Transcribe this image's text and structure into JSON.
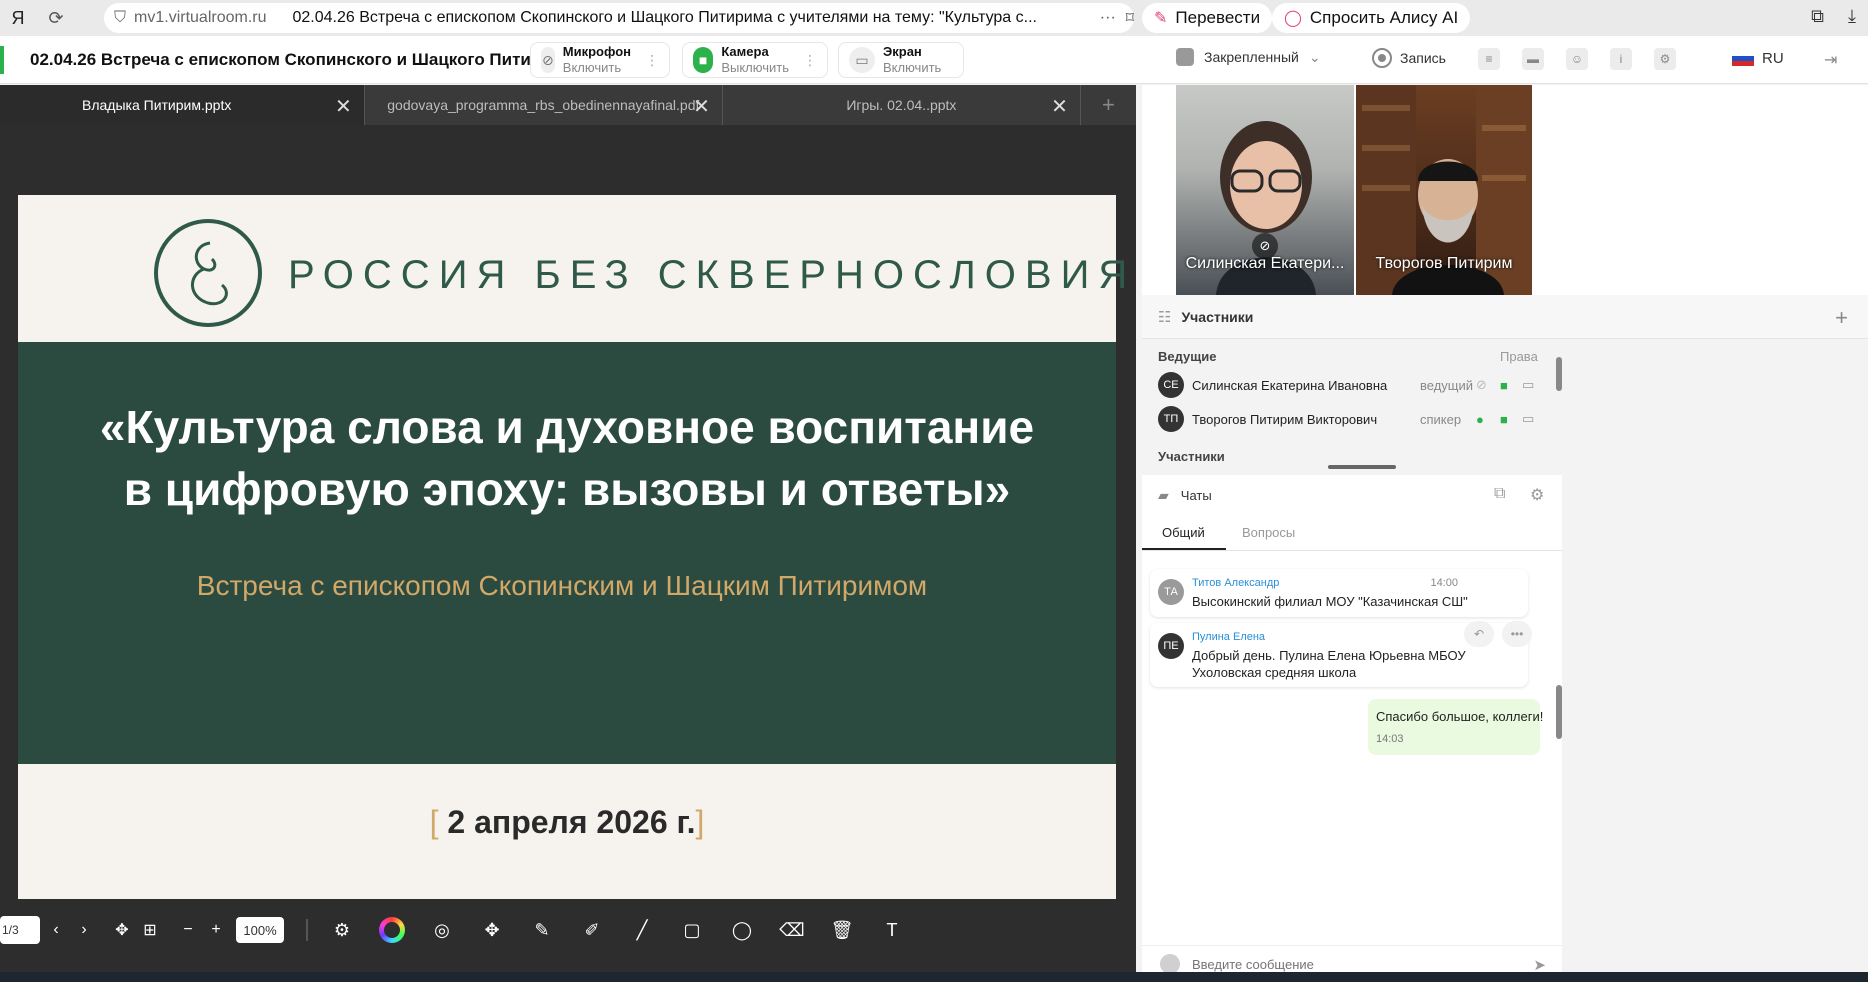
{
  "browser": {
    "domain": "mv1.virtualroom.ru",
    "page_title": "02.04.26 Встреча с епископом Скопинского и Шацкого Питирима с учителями на тему: \"Культура с...",
    "translate_label": "Перевести",
    "alice_label": "Спросить Алису AI"
  },
  "header": {
    "title": "02.04.26 Встреча с епископом Скопинского и Шацкого Питирима ...",
    "mic": {
      "label": "Микрофон",
      "action": "Включить"
    },
    "camera": {
      "label": "Камера",
      "action": "Выключить"
    },
    "screen": {
      "label": "Экран",
      "action": "Включить"
    },
    "pinned": "Закрепленный",
    "record": "Запись",
    "lang": "RU"
  },
  "tabs": [
    {
      "label": "Владыка Питирим.pptx",
      "active": true
    },
    {
      "label": "godovaya_programma_rbs_obedinennayafinal.pdf",
      "active": false
    },
    {
      "label": "Игры. 02.04..pptx",
      "active": false
    }
  ],
  "slide": {
    "brand": "РОССИЯ БЕЗ СКВЕРНОСЛОВИЯ",
    "title_line1": "«Культура слова и духовное воспитание",
    "title_line2": "в цифровую эпоху: вызовы и ответы»",
    "subtitle": "Встреча с епископом Скопинским и Шацким Питиримом",
    "date": "2 апреля 2026 г.",
    "colors": {
      "band": "#2c4b40",
      "paper": "#f6f3ee",
      "accent": "#d1a868"
    }
  },
  "toolbar": {
    "page": "1/3",
    "zoom": "100%"
  },
  "videos": [
    {
      "name": "Силинская Екатери..."
    },
    {
      "name": "Творогов Питирим"
    }
  ],
  "participants": {
    "title": "Участники",
    "hosts_label": "Ведущие",
    "rights_label": "Права",
    "members_label": "Участники",
    "list": [
      {
        "initials": "СЕ",
        "name": "Силинская Екатерина Ивановна",
        "role": "ведущий"
      },
      {
        "initials": "ТП",
        "name": "Творогов Питирим Викторович",
        "role": "спикер"
      }
    ]
  },
  "chats": {
    "title": "Чаты",
    "tab_general": "Общий",
    "tab_questions": "Вопросы",
    "messages": [
      {
        "initials": "ТА",
        "author": "Титов Александр",
        "time": "14:00",
        "text": "Высокинский филиал МОУ \"Казачинская СШ\""
      },
      {
        "initials": "ПЕ",
        "author": "Пулина Елена",
        "time": "",
        "text": "Добрый день. Пулина Елена Юрьевна МБОУ Ухоловская средняя школа"
      }
    ],
    "mine": {
      "text": "Спасибо большое, коллеги!",
      "time": "14:03"
    },
    "input_placeholder": "Введите сообщение"
  }
}
